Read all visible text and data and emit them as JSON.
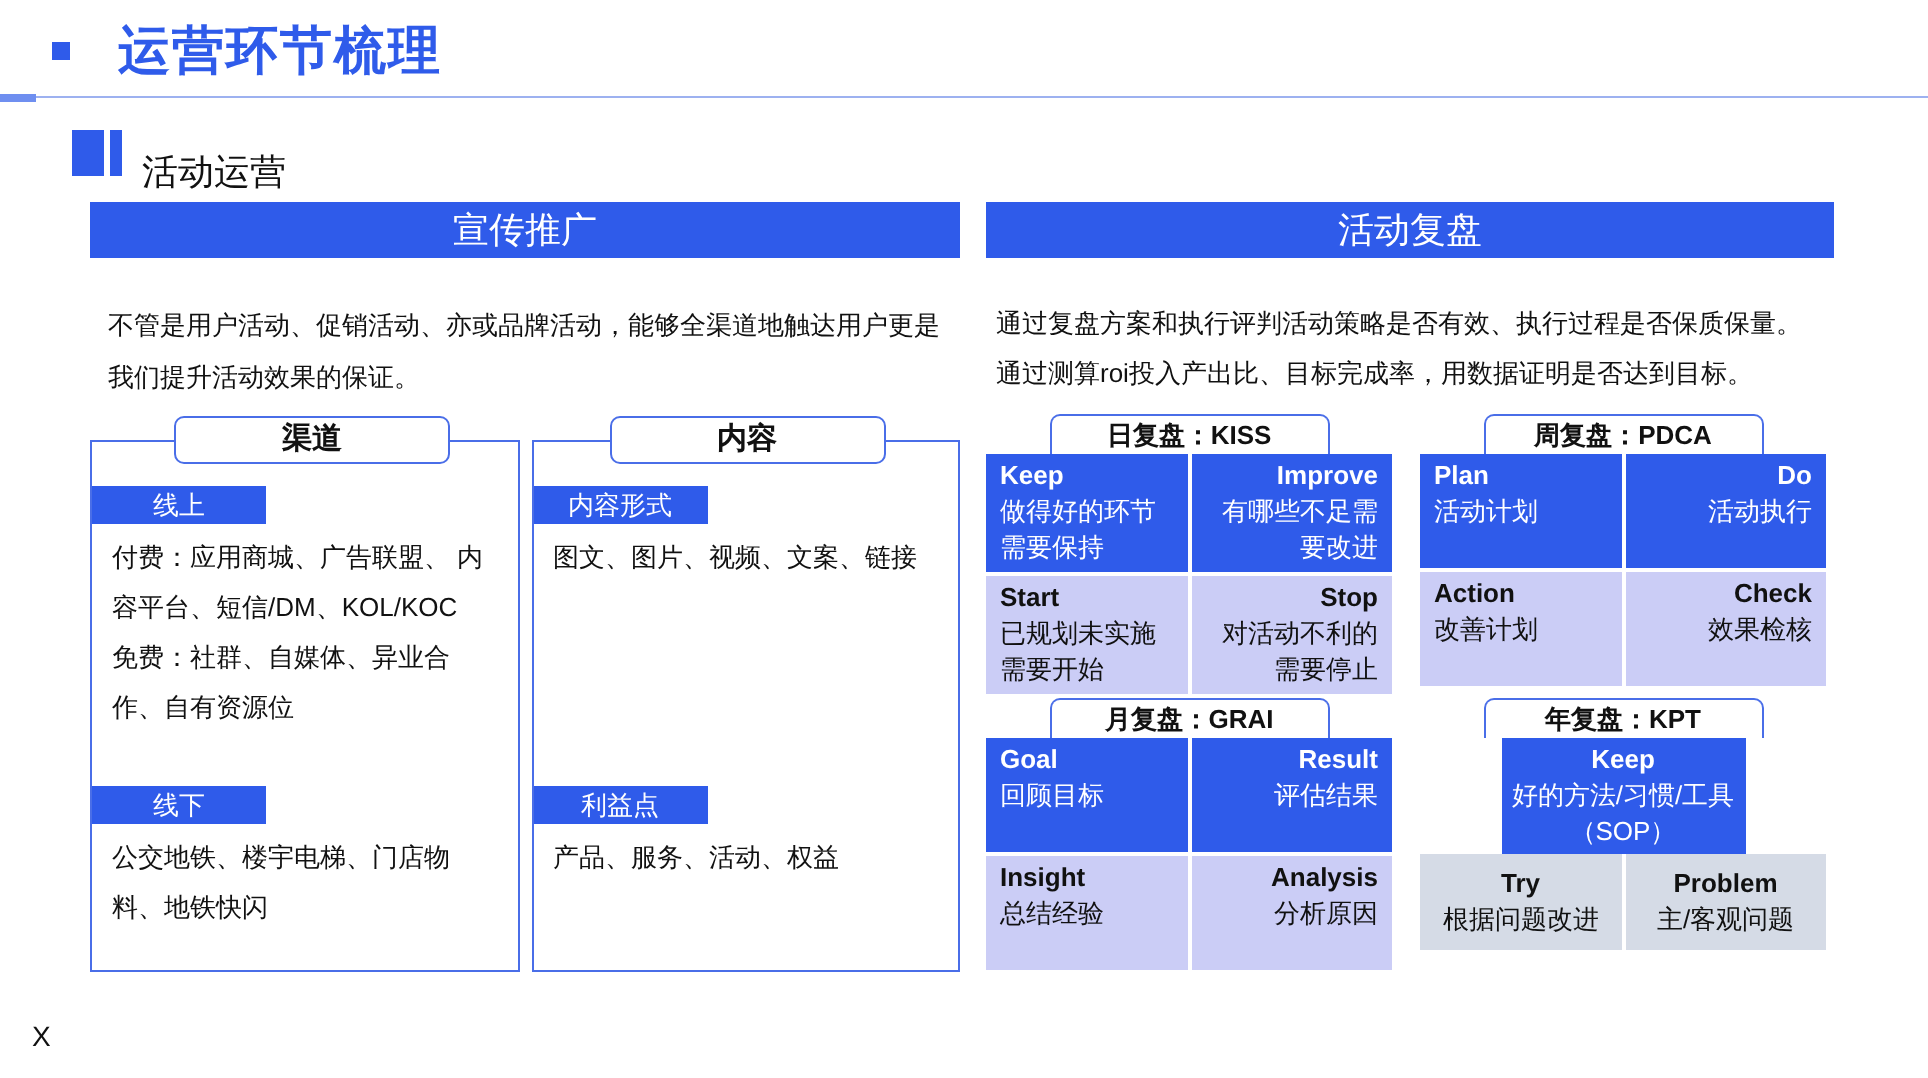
{
  "header": {
    "title": "运营环节梳理"
  },
  "section": {
    "title": "活动运营"
  },
  "promotion": {
    "title": "宣传推广",
    "description": "不管是用户活动、促销活动、亦或品牌活动，能够全渠道地触达用户更是我们提升活动效果的保证。",
    "panels": [
      {
        "title": "渠道",
        "groups": [
          {
            "label": "线上",
            "items": [
              "付费：应用商城、广告联盟、 内容平台、短信/DM、KOL/KOC",
              "免费：社群、自媒体、异业合作、自有资源位"
            ]
          },
          {
            "label": "线下",
            "items": [
              "公交地铁、楼宇电梯、门店物料、地铁快闪"
            ]
          }
        ]
      },
      {
        "title": "内容",
        "groups": [
          {
            "label": "内容形式",
            "items": [
              "图文、图片、视频、文案、链接"
            ]
          },
          {
            "label": "利益点",
            "items": [
              "产品、服务、活动、权益"
            ]
          }
        ]
      }
    ]
  },
  "review": {
    "title": "活动复盘",
    "description": [
      "通过复盘方案和执行评判活动策略是否有效、执行过程是否保质保量。",
      "通过测算roi投入产出比、目标完成率，用数据证明是否达到目标。"
    ],
    "frameworks": [
      {
        "title": "日复盘：KISS",
        "kind": "grid",
        "cells": [
          {
            "name": "Keep",
            "text": "做得好的环节需要保持",
            "color": "#2f5bea"
          },
          {
            "name": "Improve",
            "text": "有哪些不足需要改进",
            "color": "#2f5bea"
          },
          {
            "name": "Start",
            "text": "已规划未实施需要开始",
            "color": "#cbcdf6"
          },
          {
            "name": "Stop",
            "text": "对活动不利的需要停止",
            "color": "#cbcdf6"
          }
        ]
      },
      {
        "title": "周复盘：PDCA",
        "kind": "grid",
        "cells": [
          {
            "name": "Plan",
            "text": "活动计划",
            "color": "#2f5bea"
          },
          {
            "name": "Do",
            "text": "活动执行",
            "color": "#2f5bea"
          },
          {
            "name": "Action",
            "text": "改善计划",
            "color": "#cbcdf6"
          },
          {
            "name": "Check",
            "text": "效果检核",
            "color": "#cbcdf6"
          }
        ]
      },
      {
        "title": "月复盘：GRAI",
        "kind": "grid",
        "cells": [
          {
            "name": "Goal",
            "text": "回顾目标",
            "color": "#2f5bea"
          },
          {
            "name": "Result",
            "text": "评估结果",
            "color": "#2f5bea"
          },
          {
            "name": "Insight",
            "text": "总结经验",
            "color": "#cbcdf6"
          },
          {
            "name": "Analysis",
            "text": "分析原因",
            "color": "#cbcdf6"
          }
        ]
      },
      {
        "title": "年复盘：KPT",
        "kind": "pyramid",
        "cells": [
          {
            "name": "Keep",
            "text": "好的方法/习惯/工具（SOP）",
            "color": "#2f5bea"
          },
          {
            "name": "Try",
            "text": "根据问题改进",
            "color": "#d5dbe6"
          },
          {
            "name": "Problem",
            "text": "主/客观问题",
            "color": "#d5dbe6"
          }
        ]
      }
    ]
  },
  "footer_mark": "X"
}
